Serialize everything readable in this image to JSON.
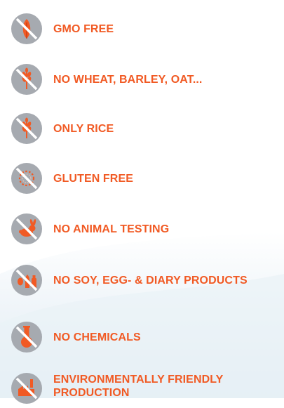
{
  "colors": {
    "label": "#f15a24",
    "icon_circle": "#a6aab0",
    "icon_symbol": "#f15a24",
    "icon_slash": "#ffffff",
    "wave": "#e3edf4"
  },
  "features": [
    {
      "icon": "leaf-icon",
      "label": "GMO FREE"
    },
    {
      "icon": "wheat-icon",
      "label": "NO WHEAT, BARLEY, OAT..."
    },
    {
      "icon": "rice-grain-icon",
      "label": "ONLY RICE"
    },
    {
      "icon": "gluten-ring-icon",
      "label": "GLUTEN FREE"
    },
    {
      "icon": "rabbit-icon",
      "label": "NO ANIMAL TESTING"
    },
    {
      "icon": "soy-egg-milk-icon",
      "label": "NO SOY, EGG- & DIARY PRODUCTS"
    },
    {
      "icon": "flask-icon",
      "label": "NO CHEMICALS"
    },
    {
      "icon": "factory-icon",
      "label": "ENVIRONMENTALLY FRIENDLY PRODUCTION"
    }
  ]
}
